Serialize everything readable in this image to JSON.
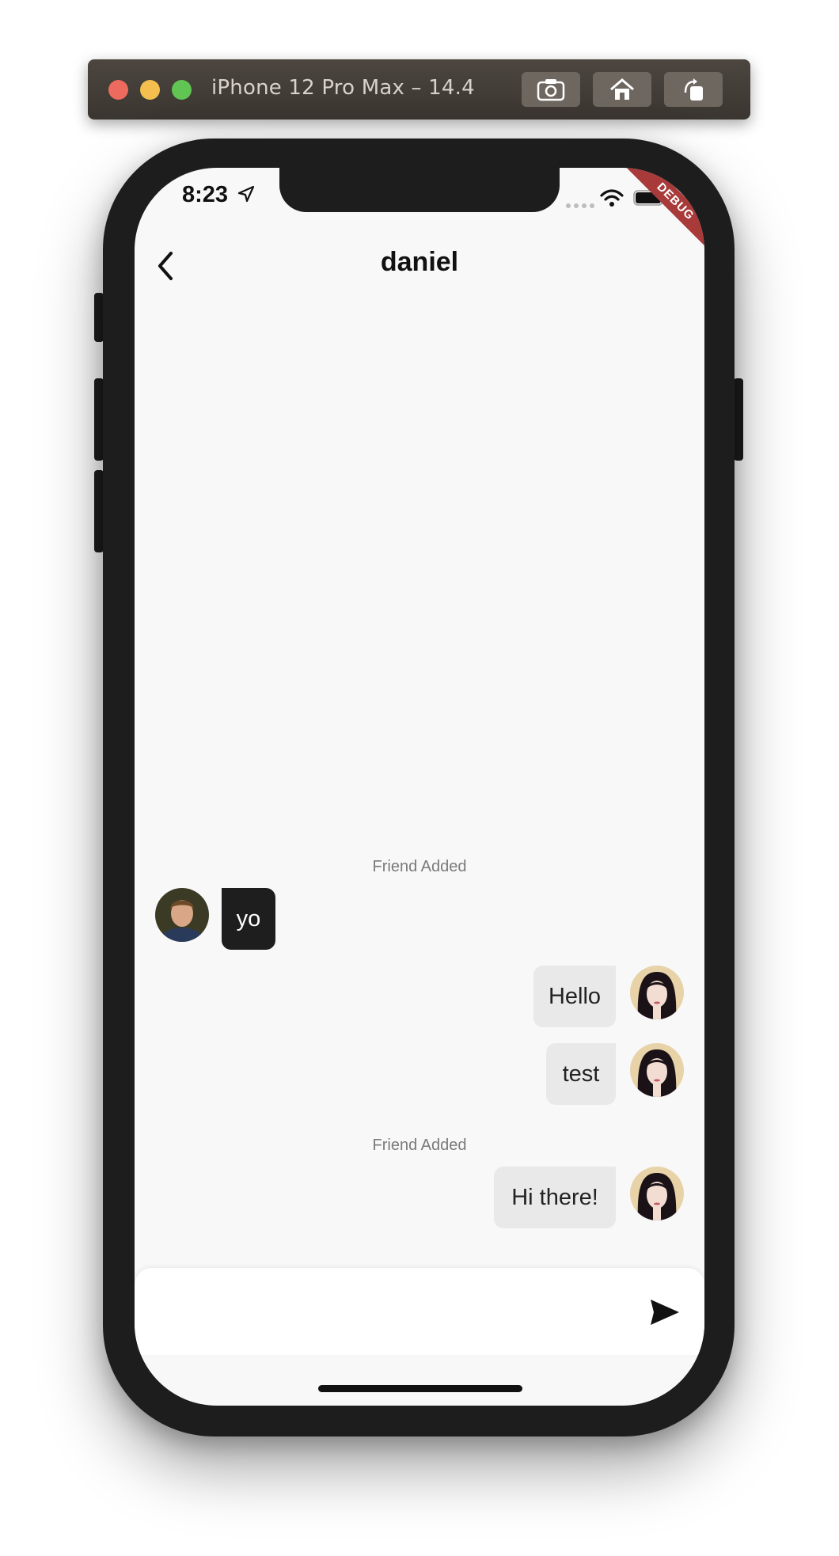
{
  "simulator": {
    "title": "iPhone 12 Pro Max – 14.4",
    "buttons": [
      "screenshot-icon",
      "home-icon",
      "rotate-icon"
    ]
  },
  "status_bar": {
    "time": "8:23",
    "debug_label": "DEBUG"
  },
  "header": {
    "title": "daniel"
  },
  "messages": [
    {
      "type": "system",
      "text": "Friend Added"
    },
    {
      "type": "incoming",
      "text": "yo"
    },
    {
      "type": "outgoing",
      "text": "Hello"
    },
    {
      "type": "outgoing",
      "text": "test"
    },
    {
      "type": "system",
      "text": "Friend Added"
    },
    {
      "type": "outgoing",
      "text": "Hi there!"
    }
  ],
  "composer": {
    "placeholder": "",
    "value": ""
  },
  "colors": {
    "incoming_bubble": "#1e1e1e",
    "outgoing_bubble": "#e9e9e9",
    "debug_banner": "#a83a3a",
    "screen_bg": "#f8f8f8"
  }
}
